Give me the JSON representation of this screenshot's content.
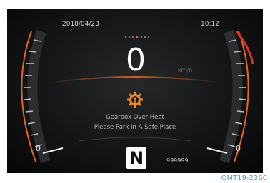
{
  "status_bar": {
    "date": "2018/04/23",
    "time": "10:12"
  },
  "speed": {
    "value": "0",
    "unit": "km/h"
  },
  "warning": {
    "icon": "gearbox-overheat-icon",
    "line1": "Gearbox Over-Heat",
    "line2": "Please Park In A Safe Place",
    "color": "#f08a1c"
  },
  "gauges": {
    "left_min_label": "0",
    "right_min_label": "0",
    "accent": "#e8661c",
    "redline": "#e0302a"
  },
  "gear": "N",
  "odometer": "999999",
  "caption": "OMT19-2360"
}
